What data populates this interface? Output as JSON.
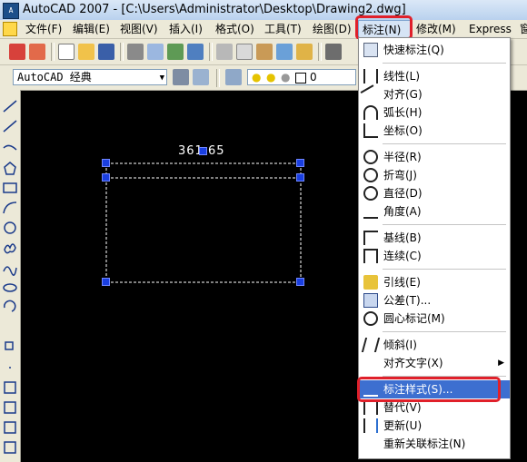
{
  "title_bar": {
    "app_icon_text": "A",
    "title": "AutoCAD 2007 - [C:\\Users\\Administrator\\Desktop\\Drawing2.dwg]"
  },
  "menu_bar": {
    "items": [
      "文件(F)",
      "编辑(E)",
      "视图(V)",
      "插入(I)",
      "格式(O)",
      "工具(T)",
      "绘图(D)",
      "标注(N)",
      "修改(M)",
      "Express",
      "窗"
    ]
  },
  "toolbar2": {
    "workspace": "AutoCAD 经典",
    "layer_value": "0"
  },
  "drawing": {
    "dimension_text": "361.65"
  },
  "dimension_menu": {
    "items": [
      {
        "label": "快速标注(Q)",
        "icon": "quick-dimension-icon"
      },
      {
        "label": "线性(L)",
        "icon": "linear-icon"
      },
      {
        "label": "对齐(G)",
        "icon": "aligned-icon"
      },
      {
        "label": "弧长(H)",
        "icon": "arc-length-icon"
      },
      {
        "label": "坐标(O)",
        "icon": "ordinate-icon"
      },
      {
        "label": "半径(R)",
        "icon": "radius-icon"
      },
      {
        "label": "折弯(J)",
        "icon": "jogged-icon"
      },
      {
        "label": "直径(D)",
        "icon": "diameter-icon"
      },
      {
        "label": "角度(A)",
        "icon": "angular-icon"
      },
      {
        "label": "基线(B)",
        "icon": "baseline-icon"
      },
      {
        "label": "连续(C)",
        "icon": "continue-icon"
      },
      {
        "label": "引线(E)",
        "icon": "leader-icon"
      },
      {
        "label": "公差(T)...",
        "icon": "tolerance-icon"
      },
      {
        "label": "圆心标记(M)",
        "icon": "center-mark-icon"
      },
      {
        "label": "倾斜(I)",
        "icon": "oblique-icon"
      },
      {
        "label": "对齐文字(X)",
        "icon": ""
      },
      {
        "label": "标注样式(S)...",
        "icon": "dimension-style-icon"
      },
      {
        "label": "替代(V)",
        "icon": "override-icon"
      },
      {
        "label": "更新(U)",
        "icon": "update-icon"
      },
      {
        "label": "重新关联标注(N)",
        "icon": ""
      }
    ]
  },
  "colors": {
    "highlight": "#3d6fd0",
    "annotation_red": "#e0202a",
    "grip_blue": "#1a3fe0"
  }
}
